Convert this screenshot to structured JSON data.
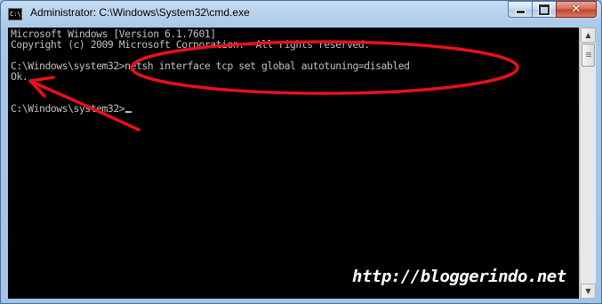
{
  "window": {
    "title": "Administrator: C:\\Windows\\System32\\cmd.exe",
    "icon_label": "C:\\",
    "icon": "cmd-console-icon"
  },
  "caption_buttons": {
    "minimize_icon": "minimize-icon",
    "maximize_icon": "maximize-icon",
    "close_icon": "close-icon",
    "close_glyph": "✕"
  },
  "console": {
    "lines": [
      "Microsoft Windows [Version 6.1.7601]",
      "Copyright (c) 2009 Microsoft Corporation.  All rights reserved.",
      "",
      "C:\\Windows\\system32>netsh interface tcp set global autotuning=disabled",
      "Ok.",
      "",
      "C:\\Windows\\system32>"
    ],
    "background": "#000000",
    "text_color": "#c0c0c0"
  },
  "annotation": {
    "watermark": "http://bloggerindo.net",
    "highlight_color": "#e8101a"
  },
  "scrollbar": {
    "up_glyph": "▲",
    "down_glyph": "▼"
  }
}
